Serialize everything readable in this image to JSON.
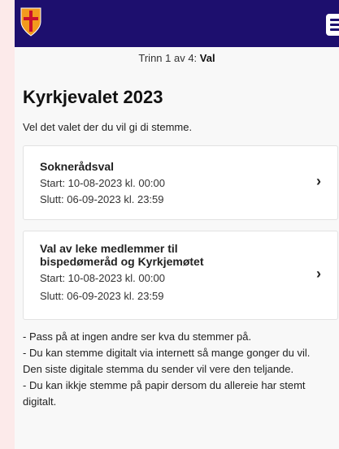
{
  "header": {
    "logo_icon": "church-cross-shield-icon",
    "menu_icon": "hamburger-menu-icon",
    "brand_color": "#1d0f6e"
  },
  "step": {
    "prefix": "Trinn 1 av 4:",
    "name": "Val"
  },
  "title": "Kyrkjevalet 2023",
  "intro": "Vel det valet der du vil gi di stemme.",
  "elections": [
    {
      "title": "Soknerådsval",
      "start": "Start: 10-08-2023 kl. 00:00",
      "end": "Slutt: 06-09-2023 kl. 23:59"
    },
    {
      "title_line1": "Val av leke medlemmer til",
      "title_line2": "bispedømeråd og Kyrkjemøtet",
      "start": "Start: 10-08-2023 kl. 00:00",
      "end": "Slutt: 06-09-2023 kl. 23:59"
    }
  ],
  "notes": {
    "line1": "- Pass på at ingen andre ser kva du stemmer på.",
    "line2": "- Du kan stemme digitalt via internett så mange gonger du vil. Den siste digitale stemma du sender vil vere den teljande.",
    "line3": "- Du kan ikkje stemme på papir dersom du allereie har stemt digitalt."
  }
}
